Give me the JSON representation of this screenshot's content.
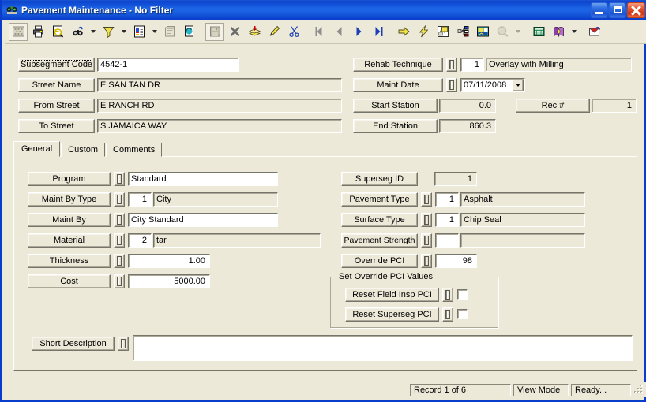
{
  "window": {
    "title": "Pavement Maintenance - No Filter",
    "icon": "app-binoculars-icon",
    "minimize_label": "Minimize",
    "maximize_label": "Maximize",
    "close_label": "Close"
  },
  "toolbar": {
    "buttons": [
      {
        "name": "select-all-icon",
        "glyph": "grid"
      },
      {
        "name": "print-icon",
        "glyph": "printer"
      },
      {
        "name": "print-preview-icon",
        "glyph": "preview"
      },
      {
        "name": "find-icon",
        "glyph": "binoculars"
      },
      {
        "name": "find-dropdown-icon",
        "glyph": "caret"
      },
      {
        "name": "filter-icon",
        "glyph": "funnel"
      },
      {
        "name": "filter-dropdown-icon",
        "glyph": "caret"
      },
      {
        "name": "report-icon",
        "glyph": "report"
      },
      {
        "name": "report-dropdown-icon",
        "glyph": "caret"
      },
      {
        "name": "properties-icon",
        "glyph": "props"
      },
      {
        "name": "refresh-icon",
        "glyph": "refresh"
      },
      {
        "name": "save-icon",
        "glyph": "disk"
      },
      {
        "name": "delete-icon",
        "glyph": "x"
      },
      {
        "name": "add-record-icon",
        "glyph": "stack"
      },
      {
        "name": "edit-icon",
        "glyph": "pencil"
      },
      {
        "name": "cut-icon",
        "glyph": "scissors"
      },
      {
        "name": "first-record-icon",
        "glyph": "first"
      },
      {
        "name": "previous-record-icon",
        "glyph": "prev"
      },
      {
        "name": "next-record-icon",
        "glyph": "next"
      },
      {
        "name": "last-record-icon",
        "glyph": "last"
      },
      {
        "name": "goto-icon",
        "glyph": "arrow"
      },
      {
        "name": "lightning-icon",
        "glyph": "bolt"
      },
      {
        "name": "map-icon",
        "glyph": "map"
      },
      {
        "name": "tree-icon",
        "glyph": "tree"
      },
      {
        "name": "gis-icon",
        "glyph": "gis"
      },
      {
        "name": "zoom-icon",
        "glyph": "magnifier"
      },
      {
        "name": "zoom-dropdown-icon",
        "glyph": "caret"
      },
      {
        "name": "calculator-icon",
        "glyph": "calc"
      },
      {
        "name": "help-book-icon",
        "glyph": "book"
      },
      {
        "name": "help-dropdown-icon",
        "glyph": "caret"
      },
      {
        "name": "exit-icon",
        "glyph": "exit"
      }
    ]
  },
  "header": {
    "left_fields": [
      {
        "label": "Subsegment Code",
        "value": "4542-1",
        "focused": true,
        "readonly": false
      },
      {
        "label": "Street Name",
        "value": "E SAN TAN DR",
        "readonly": true
      },
      {
        "label": "From Street",
        "value": "E RANCH RD",
        "readonly": true
      },
      {
        "label": "To Street",
        "value": "S JAMAICA WAY",
        "readonly": true
      }
    ],
    "rehab_technique": {
      "label": "Rehab Technique",
      "code": "1",
      "description": "Overlay with Milling"
    },
    "maint_date": {
      "label": "Maint Date",
      "value": "07/11/2008"
    },
    "start_station": {
      "label": "Start Station",
      "value": "0.0"
    },
    "end_station": {
      "label": "End Station",
      "value": "860.3"
    },
    "rec_number": {
      "label": "Rec #",
      "value": "1"
    }
  },
  "tabs": [
    {
      "label": "General",
      "active": true
    },
    {
      "label": "Custom",
      "active": false
    },
    {
      "label": "Comments",
      "active": false
    }
  ],
  "general": {
    "left": [
      {
        "label": "Program",
        "code": null,
        "value": "Standard",
        "readonly": false
      },
      {
        "label": "Maint By Type",
        "code": "1",
        "value": "City",
        "readonly": true
      },
      {
        "label": "Maint By",
        "code": null,
        "value": "City Standard",
        "readonly": false
      },
      {
        "label": "Material",
        "code": "2",
        "value": "tar",
        "readonly": true
      },
      {
        "label": "Thickness",
        "code": null,
        "value": "1.00",
        "numeric": true
      },
      {
        "label": "Cost",
        "code": null,
        "value": "5000.00",
        "numeric": true
      }
    ],
    "right": [
      {
        "label": "Superseg ID",
        "code": null,
        "value": "1",
        "readonly": true,
        "numeric": true,
        "nolookup": true
      },
      {
        "label": "Pavement Type",
        "code": "1",
        "value": "Asphalt",
        "readonly": true
      },
      {
        "label": "Surface Type",
        "code": "1",
        "value": "Chip Seal",
        "readonly": true
      },
      {
        "label": "Pavement Strength",
        "code": "",
        "value": "",
        "readonly": true
      },
      {
        "label": "Override PCI",
        "code": null,
        "value": "98",
        "numeric": true
      }
    ],
    "override_group": {
      "title": "Set Override PCI Values",
      "rows": [
        {
          "label": "Reset Field Insp PCI",
          "checked": false
        },
        {
          "label": "Reset Superseg PCI",
          "checked": false
        }
      ]
    },
    "short_description": {
      "label": "Short Description",
      "value": ""
    }
  },
  "statusbar": {
    "record": "Record 1 of 6",
    "mode": "View Mode",
    "state": "Ready..."
  },
  "colors": {
    "titlebar_blue": "#0a3ccb",
    "face": "#ece9d8",
    "shadow": "#77746a",
    "field_white": "#ffffff"
  }
}
